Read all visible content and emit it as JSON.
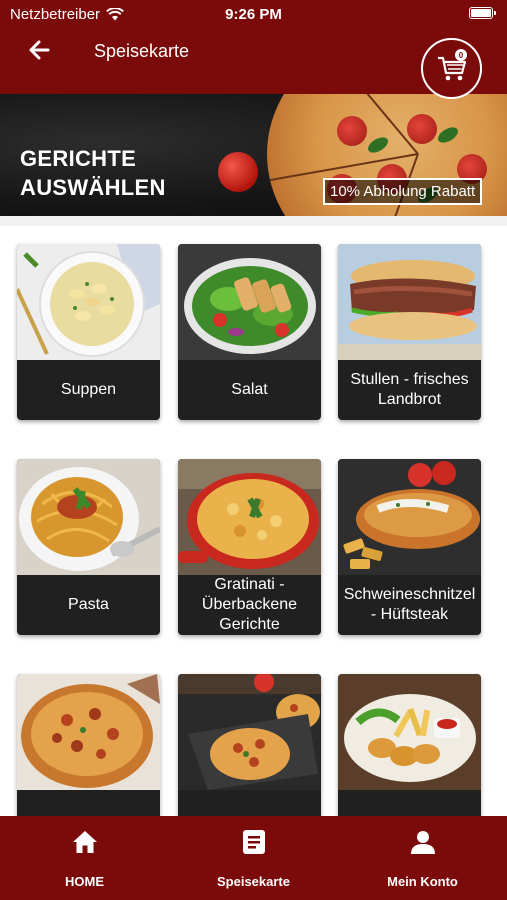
{
  "status_bar": {
    "carrier": "Netzbetreiber",
    "time": "9:26 PM"
  },
  "header": {
    "title": "Speisekarte",
    "cart_count": "0"
  },
  "banner": {
    "title_line1": "GERICHTE",
    "title_line2": "AUSWÄHLEN",
    "promo": "10% Abholung Rabatt"
  },
  "categories": [
    {
      "label": "Suppen"
    },
    {
      "label": "Salat"
    },
    {
      "label": "Stullen - frisches Landbrot"
    },
    {
      "label": "Pasta"
    },
    {
      "label": "Gratinati - Überbackene Gerichte"
    },
    {
      "label": "Schweineschnitzel - Hüftsteak"
    },
    {
      "label": ""
    },
    {
      "label": ""
    },
    {
      "label": ""
    }
  ],
  "nav": {
    "home": "HOME",
    "menu": "Speisekarte",
    "account": "Mein Konto"
  },
  "colors": {
    "brand": "#7b0a0a",
    "card_label_bg": "#202020"
  }
}
